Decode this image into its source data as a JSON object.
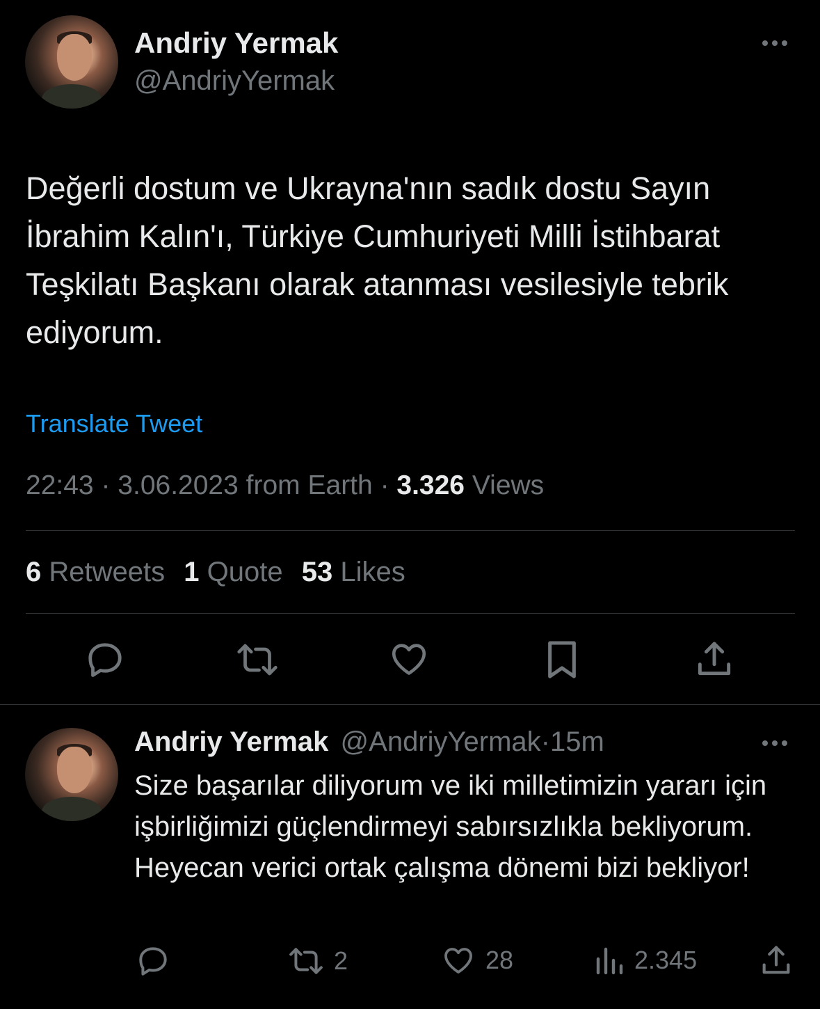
{
  "main_tweet": {
    "author_name": "Andriy Yermak",
    "author_handle": "@AndriyYermak",
    "text": "Değerli dostum ve Ukrayna'nın sadık dostu Sayın İbrahim Kalın'ı, Türkiye Cumhuriyeti Milli İstihbarat Teşkilatı Başkanı olarak atanması vesilesiyle tebrik ediyorum.",
    "translate_label": "Translate Tweet",
    "time": "22:43",
    "date": "3.06.2023",
    "source": "from Earth",
    "separator": "·",
    "views_count": "3.326",
    "views_label": "Views",
    "retweets_count": "6",
    "retweets_label": "Retweets",
    "quotes_count": "1",
    "quotes_label": "Quote",
    "likes_count": "53",
    "likes_label": "Likes"
  },
  "reply_tweet": {
    "author_name": "Andriy Yermak",
    "author_handle": "@AndriyYermak",
    "separator": "·",
    "timestamp": "15m",
    "text": "Size başarılar diliyorum ve iki milletimizin yararı için işbirliğimizi güçlendirmeyi sabırsızlıkla bekliyorum. Heyecan verici ortak çalışma dönemi bizi bekliyor!",
    "retweets_count": "2",
    "likes_count": "28",
    "views_count": "2.345"
  },
  "colors": {
    "background": "#000000",
    "text": "#e7e9ea",
    "muted": "#71767b",
    "link": "#1d9bf0",
    "divider": "#2f3336"
  },
  "icons": [
    "more-icon",
    "reply-icon",
    "retweet-icon",
    "like-icon",
    "bookmark-icon",
    "share-icon",
    "views-icon"
  ]
}
